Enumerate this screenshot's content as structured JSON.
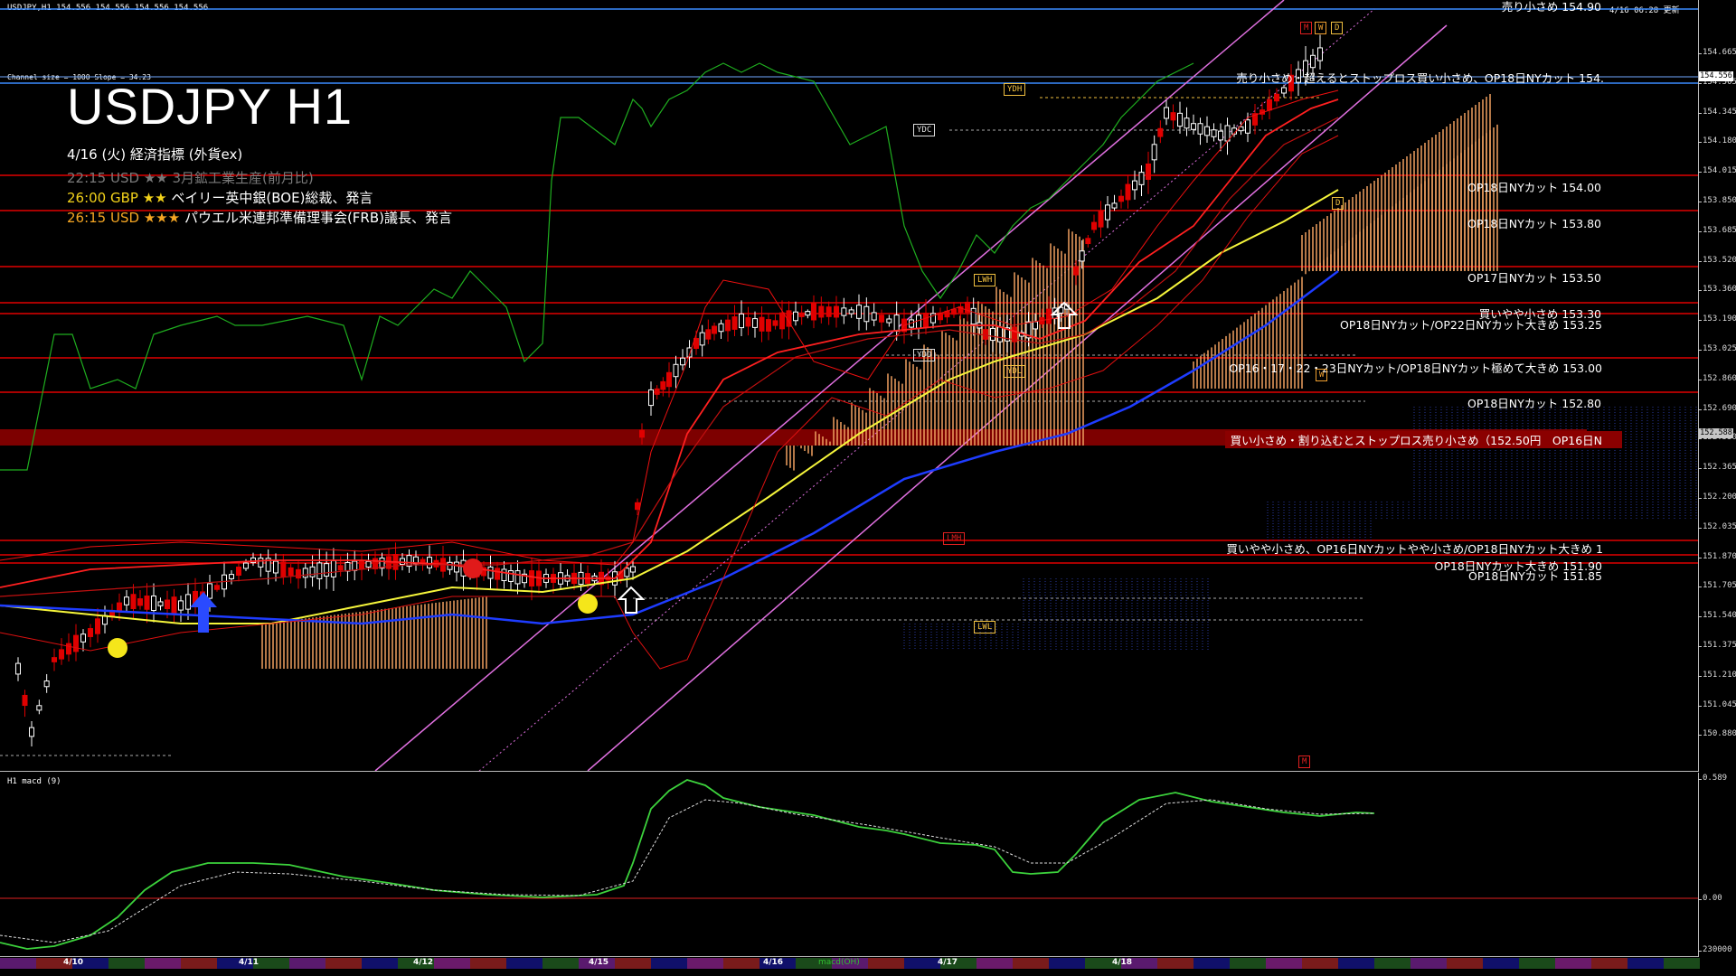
{
  "header": {
    "symbol_info": "USDJPY,H1  154.556 154.556 154.556 154.556",
    "timestamp": "4/16 06:28 更新",
    "channel_info": "Channel size = 1000 Slope = 34.23"
  },
  "chart_title": "USDJPY H1",
  "events": {
    "title": "4/16 (火) 経済指標 (外貨ex)",
    "items": [
      {
        "time": "22:15",
        "cur": "USD",
        "stars": "★★",
        "desc": "3月鉱工業生産(前月比)",
        "color": "#7a7a7a"
      },
      {
        "time": "26:00",
        "cur": "GBP",
        "stars": "★★",
        "desc": "ベイリー英中銀(BOE)総裁、発言",
        "color": "#f2d21a"
      },
      {
        "time": "26:15",
        "cur": "USD",
        "stars": "★★★",
        "desc": "パウエル米連邦準備理事会(FRB)議長、発言",
        "color": "#f5a623"
      }
    ]
  },
  "price_axis": {
    "labels": [
      "154.665",
      "154.505",
      "154.345",
      "154.180",
      "154.015",
      "153.850",
      "153.685",
      "153.520",
      "153.360",
      "153.190",
      "153.025",
      "152.860",
      "152.690",
      "152.530",
      "152.365",
      "152.200",
      "152.035",
      "151.870",
      "151.705",
      "151.540",
      "151.375",
      "151.210",
      "151.045",
      "150.880"
    ],
    "current_price": "154.556",
    "mid_price": "152.588"
  },
  "levels": [
    {
      "text": "売り小さめ 154.90",
      "color": "#ffffff"
    },
    {
      "text": "売り小さめ・超えるとストップロス買い小さめ、OP18日NYカット 154.",
      "color": "#ffffff"
    },
    {
      "text": "OP18日NYカット 154.00",
      "color": "#ffffff"
    },
    {
      "text": "OP18日NYカット 153.80",
      "color": "#ffffff"
    },
    {
      "text": "OP17日NYカット 153.50",
      "color": "#ffffff"
    },
    {
      "text": "買いやや小さめ 153.30",
      "color": "#ffffff"
    },
    {
      "text": "OP18日NYカット/OP22日NYカット大きめ 153.25",
      "color": "#ffffff"
    },
    {
      "text": "OP16・17・22・23日NYカット/OP18日NYカット極めて大きめ 153.00",
      "color": "#ffffff"
    },
    {
      "text": "OP18日NYカット 152.80",
      "color": "#ffffff"
    },
    {
      "text": "買い小さめ・割り込むとストップロス売り小さめ（152.50円　OP16日N",
      "color": "#ffffff"
    },
    {
      "text": "買いやや小さめ、OP16日NYカットやや小さめ/OP18日NYカット大きめ 1",
      "color": "#ffffff"
    },
    {
      "text": "OP18日NYカット大きめ 151.90",
      "color": "#ffffff"
    },
    {
      "text": "OP18日NYカット 151.85",
      "color": "#ffffff"
    }
  ],
  "tags": {
    "ydh": "YDH",
    "ydc": "YDC",
    "ydo": "YDO",
    "ydl": "YDL",
    "lwh": "LWH",
    "lwl": "LWL",
    "lmh": "LMH",
    "m": "M",
    "w": "W",
    "d": "D",
    "m2": "M",
    "w2": "W",
    "d2": "D"
  },
  "macd": {
    "title": "H1  macd (9)",
    "axis_labels": [
      "0.589",
      "0.00",
      "230000"
    ],
    "legend": "macd(OH)"
  },
  "date_axis": {
    "labels": [
      "4/10",
      "4/11",
      "4/12",
      "4/15",
      "4/16",
      "4/17",
      "4/18"
    ]
  },
  "colors": {
    "support_line": "#e00000",
    "zone": "#8b0000",
    "upper_line": "#3b8cff",
    "candle_up": "#ffffff",
    "candle_down": "#e00000",
    "kumo": "#f0a060",
    "ma_yellow": "#f5f53b",
    "ma_blue": "#1e3cff",
    "macd_line": "#3cd23c",
    "macd_signal": "#dddddd",
    "channel": "#e070e0"
  }
}
